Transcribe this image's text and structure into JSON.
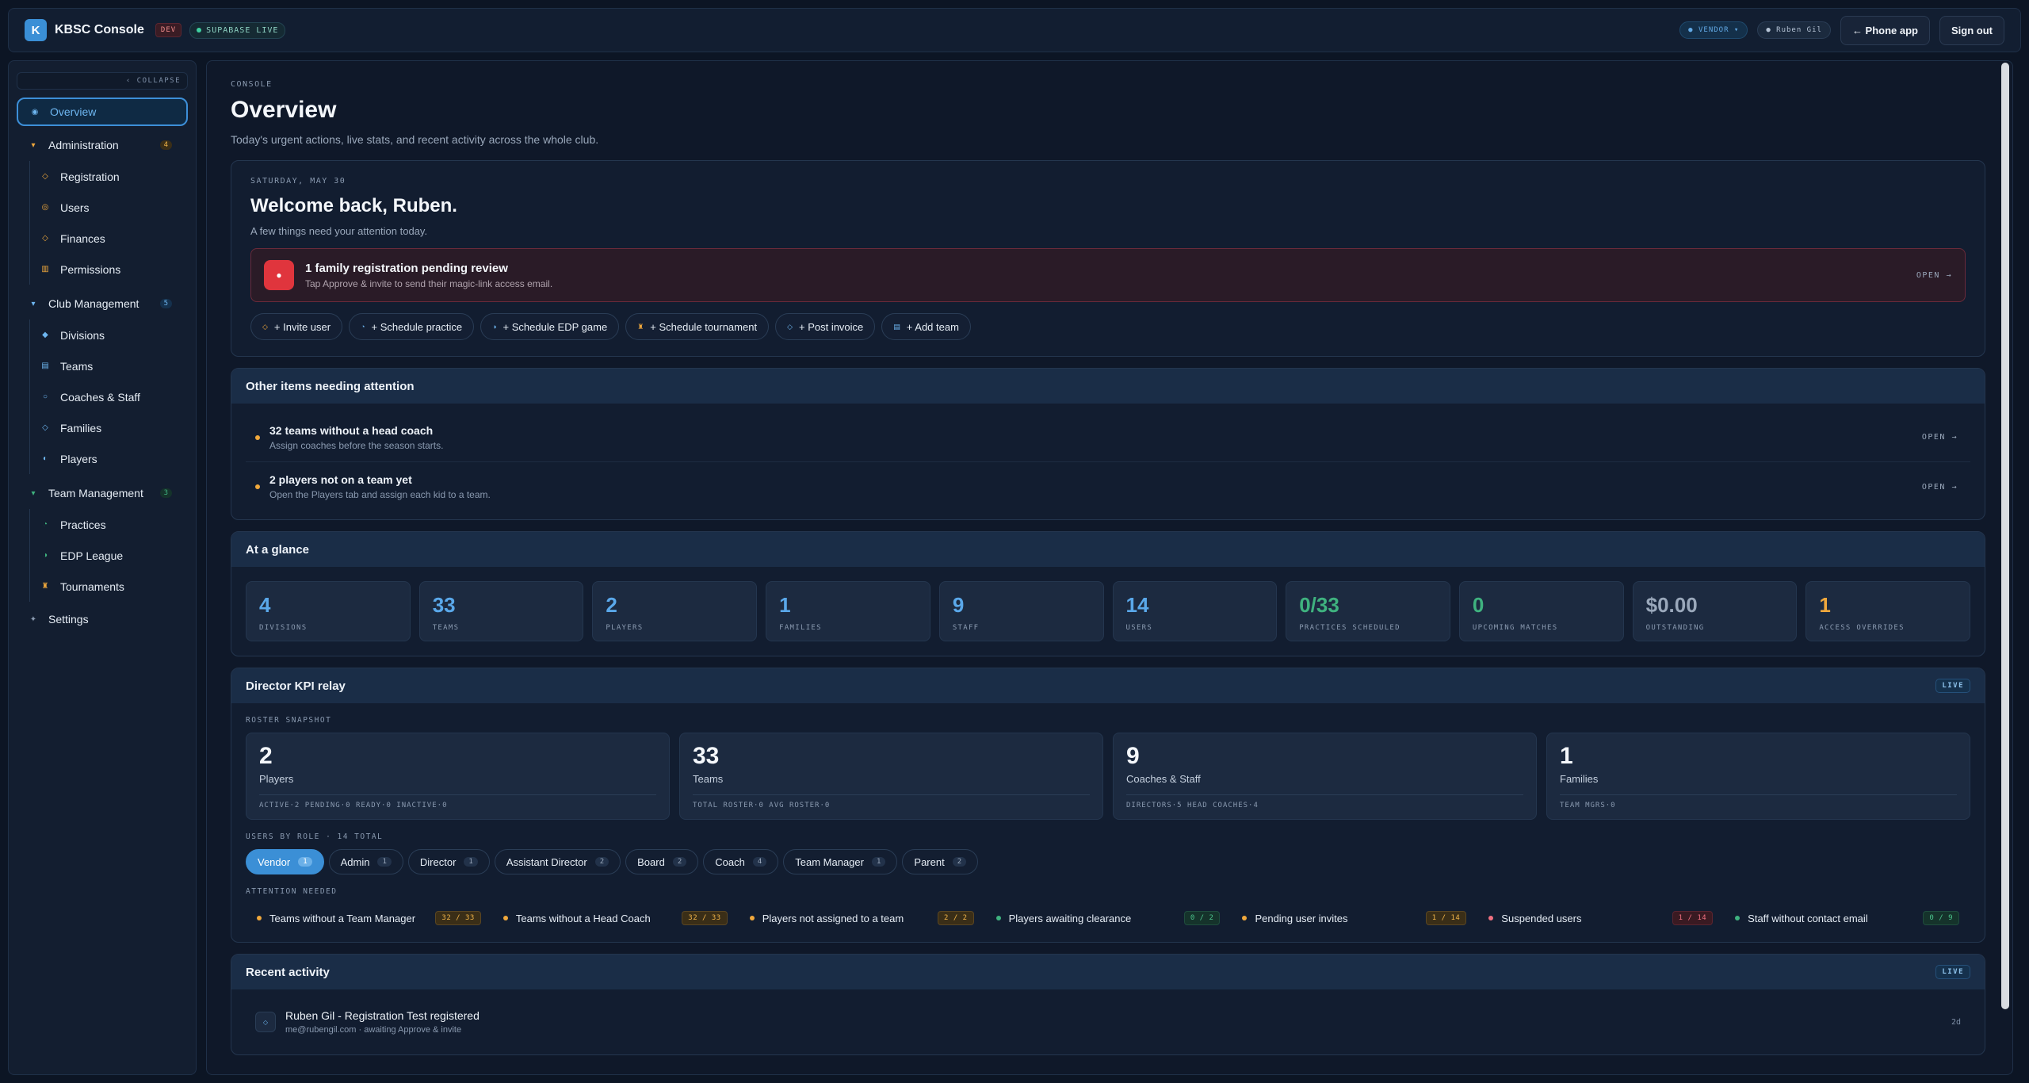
{
  "topbar": {
    "logo_letter": "K",
    "app_name": "KBSC Console",
    "env_badge": "DEV",
    "live_badge": "SUPABASE LIVE",
    "role_pill": "● VENDOR ▾",
    "user_pill": "● Ruben Gil",
    "phone_app_button": "← Phone app",
    "sign_out_button": "Sign out"
  },
  "sidebar": {
    "collapse_label": "‹ COLLAPSE",
    "overview": "Overview",
    "groups": [
      {
        "label": "Administration",
        "count": "4",
        "items": [
          "Registration",
          "Users",
          "Finances",
          "Permissions"
        ]
      },
      {
        "label": "Club Management",
        "count": "5",
        "items": [
          "Divisions",
          "Teams",
          "Coaches & Staff",
          "Families",
          "Players"
        ]
      },
      {
        "label": "Team Management",
        "count": "3",
        "items": [
          "Practices",
          "EDP League",
          "Tournaments"
        ]
      }
    ],
    "settings": "Settings"
  },
  "page": {
    "eyebrow": "CONSOLE",
    "title": "Overview",
    "subtitle": "Today's urgent actions, live stats, and recent activity across the whole club."
  },
  "welcome": {
    "date": "SATURDAY, MAY 30",
    "heading": "Welcome back, Ruben.",
    "sub": "A few things need your attention today.",
    "alert_title": "1 family registration pending review",
    "alert_sub": "Tap Approve & invite to send their magic-link access email.",
    "alert_open": "OPEN →",
    "quick_actions": [
      "+ Invite user",
      "+ Schedule practice",
      "+ Schedule EDP game",
      "+ Schedule tournament",
      "+ Post invoice",
      "+ Add team"
    ]
  },
  "attention": {
    "title": "Other items needing attention",
    "items": [
      {
        "title": "32 teams without a head coach",
        "sub": "Assign coaches before the season starts.",
        "open": "OPEN →"
      },
      {
        "title": "2 players not on a team yet",
        "sub": "Open the Players tab and assign each kid to a team.",
        "open": "OPEN →"
      }
    ]
  },
  "glance": {
    "title": "At a glance",
    "stats": [
      {
        "value": "4",
        "label": "DIVISIONS"
      },
      {
        "value": "33",
        "label": "TEAMS"
      },
      {
        "value": "2",
        "label": "PLAYERS"
      },
      {
        "value": "1",
        "label": "FAMILIES"
      },
      {
        "value": "9",
        "label": "STAFF"
      },
      {
        "value": "14",
        "label": "USERS"
      },
      {
        "value": "0/33",
        "label": "PRACTICES SCHEDULED"
      },
      {
        "value": "0",
        "label": "UPCOMING MATCHES"
      },
      {
        "value": "$0.00",
        "label": "OUTSTANDING"
      },
      {
        "value": "1",
        "label": "ACCESS OVERRIDES"
      }
    ]
  },
  "kpi": {
    "title": "Director KPI relay",
    "live": "LIVE",
    "roster_label": "ROSTER SNAPSHOT",
    "roster": [
      {
        "value": "2",
        "label": "Players",
        "detail": "ACTIVE·2  PENDING·0  READY·0  INACTIVE·0"
      },
      {
        "value": "33",
        "label": "Teams",
        "detail": "TOTAL ROSTER·0  AVG ROSTER·0"
      },
      {
        "value": "9",
        "label": "Coaches & Staff",
        "detail": "DIRECTORS·5  HEAD COACHES·4"
      },
      {
        "value": "1",
        "label": "Families",
        "detail": "TEAM MGRS·0"
      }
    ],
    "roles_label": "USERS BY ROLE · 14 TOTAL",
    "roles": [
      {
        "name": "Vendor",
        "count": "1"
      },
      {
        "name": "Admin",
        "count": "1"
      },
      {
        "name": "Director",
        "count": "1"
      },
      {
        "name": "Assistant Director",
        "count": "2"
      },
      {
        "name": "Board",
        "count": "2"
      },
      {
        "name": "Coach",
        "count": "4"
      },
      {
        "name": "Team Manager",
        "count": "1"
      },
      {
        "name": "Parent",
        "count": "2"
      }
    ],
    "needed_label": "ATTENTION NEEDED",
    "needed": [
      {
        "label": "Teams without a Team Manager",
        "count": "32 / 33"
      },
      {
        "label": "Teams without a Head Coach",
        "count": "32 / 33"
      },
      {
        "label": "Players not assigned to a team",
        "count": "2 / 2"
      },
      {
        "label": "Players awaiting clearance",
        "count": "0 / 2"
      },
      {
        "label": "Pending user invites",
        "count": "1 / 14"
      },
      {
        "label": "Suspended users",
        "count": "1 / 14"
      },
      {
        "label": "Staff without contact email",
        "count": "0 / 9"
      }
    ]
  },
  "activity": {
    "title": "Recent activity",
    "live": "LIVE",
    "items": [
      {
        "title": "Ruben Gil - Registration Test registered",
        "sub": "me@rubengil.com · awaiting Approve & invite",
        "time": "2d"
      }
    ]
  },
  "colors": {
    "accent": "#3b8fd6",
    "amber": "#f0a83c",
    "green": "#3fb27f",
    "red": "#e0353d"
  }
}
